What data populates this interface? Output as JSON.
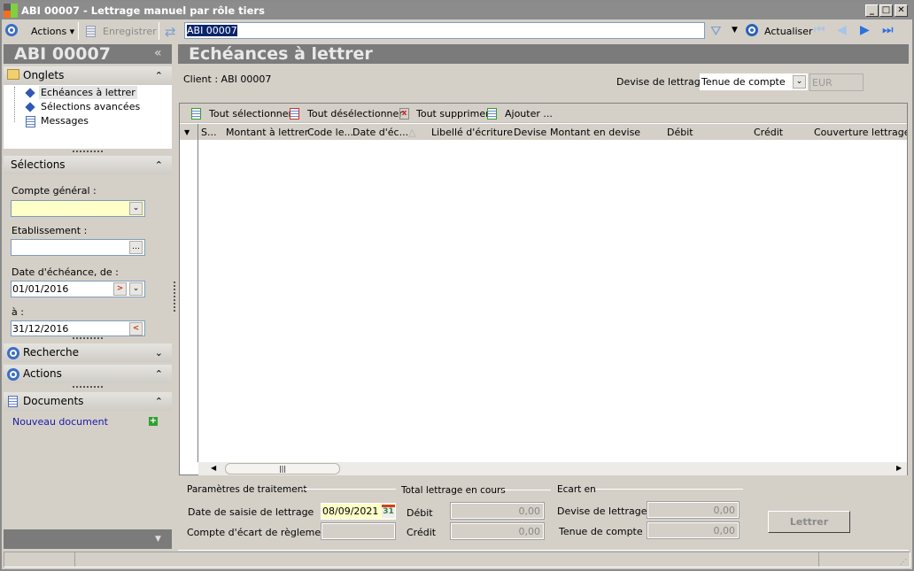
{
  "window": {
    "title": "ABI 00007 -  Lettrage manuel par rôle tiers"
  },
  "toolbar": {
    "actions": "Actions",
    "save": "Enregistrer",
    "record": "ABI 00007",
    "refresh": "Actualiser"
  },
  "left": {
    "title": "ABI 00007",
    "onglets": {
      "title": "Onglets",
      "items": [
        "Echéances à lettrer",
        "Sélections avancées",
        "Messages"
      ]
    },
    "selections": {
      "title": "Sélections",
      "compte_label": "Compte général :",
      "compte_value": "",
      "etab_label": "Etablissement :",
      "etab_value": "",
      "date_de_label": "Date d'échéance, de :",
      "date_de": "01/01/2016",
      "date_a_label": "à :",
      "date_a": "31/12/2016"
    },
    "recherche": "Recherche",
    "actions": "Actions",
    "documents": "Documents",
    "new_doc": "Nouveau document"
  },
  "main": {
    "title": "Echéances à lettrer",
    "client": "Client : ABI 00007",
    "devise_label": "Devise de lettrage :",
    "devise_value": "Tenue de compte",
    "devise_code": "EUR",
    "grid_toolbar": [
      "Tout sélectionner",
      "Tout désélectionner",
      "Tout supprimer",
      "Ajouter ..."
    ],
    "columns": [
      "S...",
      "Montant à lettrer",
      "Code le...",
      "Date d'éc...",
      "Libellé d'écriture",
      "Devise",
      "Montant en devise",
      "Débit",
      "Crédit",
      "Couverture lettrage E"
    ]
  },
  "bottom": {
    "params": "Paramètres de traitement",
    "date_saisie_label": "Date de saisie de lettrage",
    "date_saisie": "08/09/2021",
    "compte_ecart_label": "Compte d'écart de règlement",
    "compte_ecart": "",
    "total": "Total lettrage en cours",
    "debit_label": "Débit",
    "debit": "0,00",
    "credit_label": "Crédit",
    "credit": "0,00",
    "ecart": "Ecart en",
    "ecart_devise_label": "Devise de lettrage",
    "ecart_devise": "0,00",
    "ecart_tenue_label": "Tenue de compte",
    "ecart_tenue": "0,00",
    "lettrer": "Lettrer",
    "cal_day": "31"
  }
}
